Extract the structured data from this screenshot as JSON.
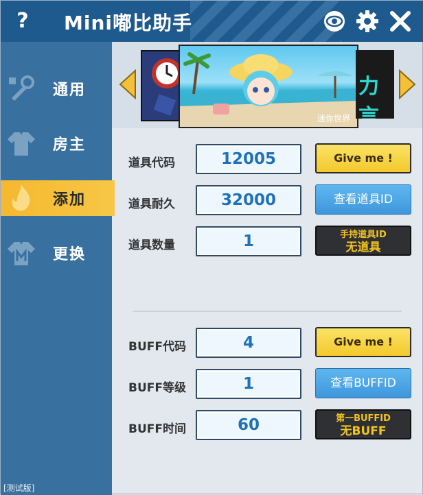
{
  "titlebar": {
    "title": "Mini嘟比助手",
    "icons": [
      "help-icon",
      "eye-icon",
      "gear-icon",
      "close-icon"
    ],
    "help_glyph": "?"
  },
  "sidebar": {
    "items": [
      {
        "label": "通用",
        "icon": "wrench-icon",
        "active": false
      },
      {
        "label": "房主",
        "icon": "shirt-icon",
        "active": false
      },
      {
        "label": "添加",
        "icon": "fire-icon",
        "active": true
      },
      {
        "label": "更换",
        "icon": "shirt-m-icon",
        "active": false
      }
    ],
    "version": "[测试版]"
  },
  "banner": {
    "right_slide_text": "力言"
  },
  "item_section": {
    "rows": [
      {
        "label": "道具代码",
        "value": "12005"
      },
      {
        "label": "道具耐久",
        "value": "32000"
      },
      {
        "label": "道具数量",
        "value": "1"
      }
    ],
    "buttons": {
      "give": "Give me !",
      "view_id": "查看道具ID",
      "held_line1": "手持道具ID",
      "held_line2": "无道具"
    }
  },
  "buff_section": {
    "rows": [
      {
        "label": "BUFF代码",
        "value": "4"
      },
      {
        "label": "BUFF等级",
        "value": "1"
      },
      {
        "label": "BUFF时间",
        "value": "60"
      }
    ],
    "buttons": {
      "give": "Give me !",
      "view_id": "查看BUFFID",
      "first_line1": "第一BUFFID",
      "first_line2": "无BUFF"
    }
  },
  "colors": {
    "titlebar": "#1f5a8e",
    "sidebar": "#38709f",
    "active_tab": "#f5b830",
    "value_text": "#1f72b8",
    "yellow_button": "#f3c92c",
    "blue_button": "#3e97dc",
    "dark_button_text": "#f4c422"
  }
}
